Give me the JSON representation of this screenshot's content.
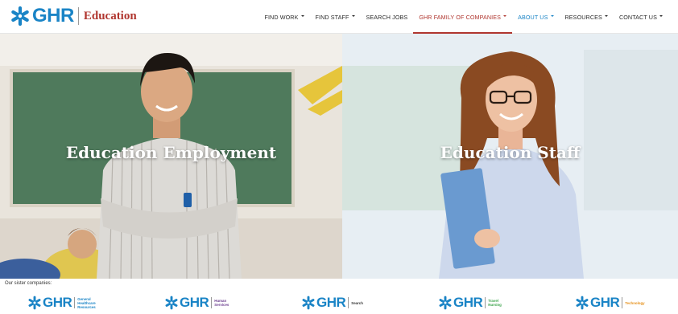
{
  "header": {
    "logo_text": "GHR",
    "logo_division": "Education",
    "nav": [
      {
        "label": "FIND WORK",
        "has_menu": true
      },
      {
        "label": "FIND STAFF",
        "has_menu": true
      },
      {
        "label": "SEARCH JOBS",
        "has_menu": false
      },
      {
        "label": "GHR FAMILY OF COMPANIES",
        "has_menu": true,
        "state": "active"
      },
      {
        "label": "ABOUT US",
        "has_menu": true,
        "state": "highlighted"
      },
      {
        "label": "RESOURCES",
        "has_menu": true
      },
      {
        "label": "CONTACT US",
        "has_menu": true
      }
    ]
  },
  "panels": {
    "left_title": "Education Employment",
    "right_title": "Education Staff"
  },
  "sister": {
    "label": "Our sister companies:",
    "companies": [
      {
        "logo": "GHR",
        "name": "General\nHealthcare\nResources",
        "color": "#1a84c6"
      },
      {
        "logo": "GHR",
        "name": "Human\nServices",
        "color": "#6b3d8f"
      },
      {
        "logo": "GHR",
        "name": "Search",
        "color": "#333333"
      },
      {
        "logo": "GHR",
        "name": "Travel\nNursing",
        "color": "#3aa34a"
      },
      {
        "logo": "GHR",
        "name": "Technology",
        "color": "#e6901a"
      }
    ]
  },
  "colors": {
    "brand_blue": "#1a84c6",
    "brand_red": "#b0362f"
  },
  "icons": {
    "logo": "snowflake-star-icon",
    "caret": "caret-down-icon"
  }
}
